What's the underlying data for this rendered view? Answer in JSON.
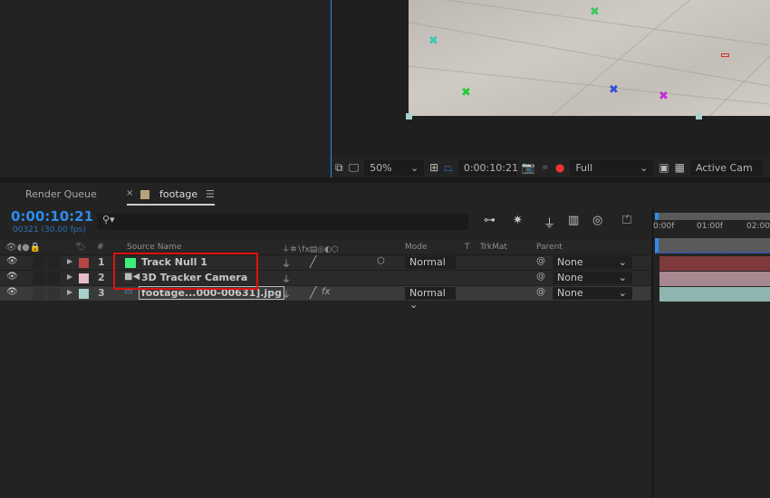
{
  "viewer": {
    "zoom": "50%",
    "timecode": "0:00:10:21",
    "resolution": "Full",
    "view": "Active Cam"
  },
  "tabs": [
    {
      "label": "Render Queue"
    },
    {
      "label": "footage",
      "color": "#b8a27a"
    }
  ],
  "timeline": {
    "timecode": "0:00:10:21",
    "frames": "00321 (30.00 fps)",
    "search_placeholder": "",
    "ruler": [
      "0:00f",
      "01:00f",
      "02:00f"
    ]
  },
  "columns": {
    "num": "#",
    "source_name": "Source Name",
    "mode": "Mode",
    "t": "T",
    "trkmat": "TrkMat",
    "parent": "Parent"
  },
  "layers": [
    {
      "num": "1",
      "name": "Track Null 1",
      "label_color": "#b84545",
      "icon": "null-icon",
      "mode": "Normal",
      "parent": "None",
      "bar_color": "#7e3a3a"
    },
    {
      "num": "2",
      "name": "3D Tracker Camera",
      "label_color": "#e8bcc8",
      "icon": "camera-icon",
      "mode": "",
      "parent": "None",
      "bar_color": "#a88890"
    },
    {
      "num": "3",
      "name": "footage...000-00631].jpg",
      "label_color": "#a9d1cc",
      "icon": "footage-icon",
      "mode": "Normal",
      "parent": "None",
      "bar_color": "#8fb5b0"
    }
  ],
  "accent": "#2d8ceb"
}
